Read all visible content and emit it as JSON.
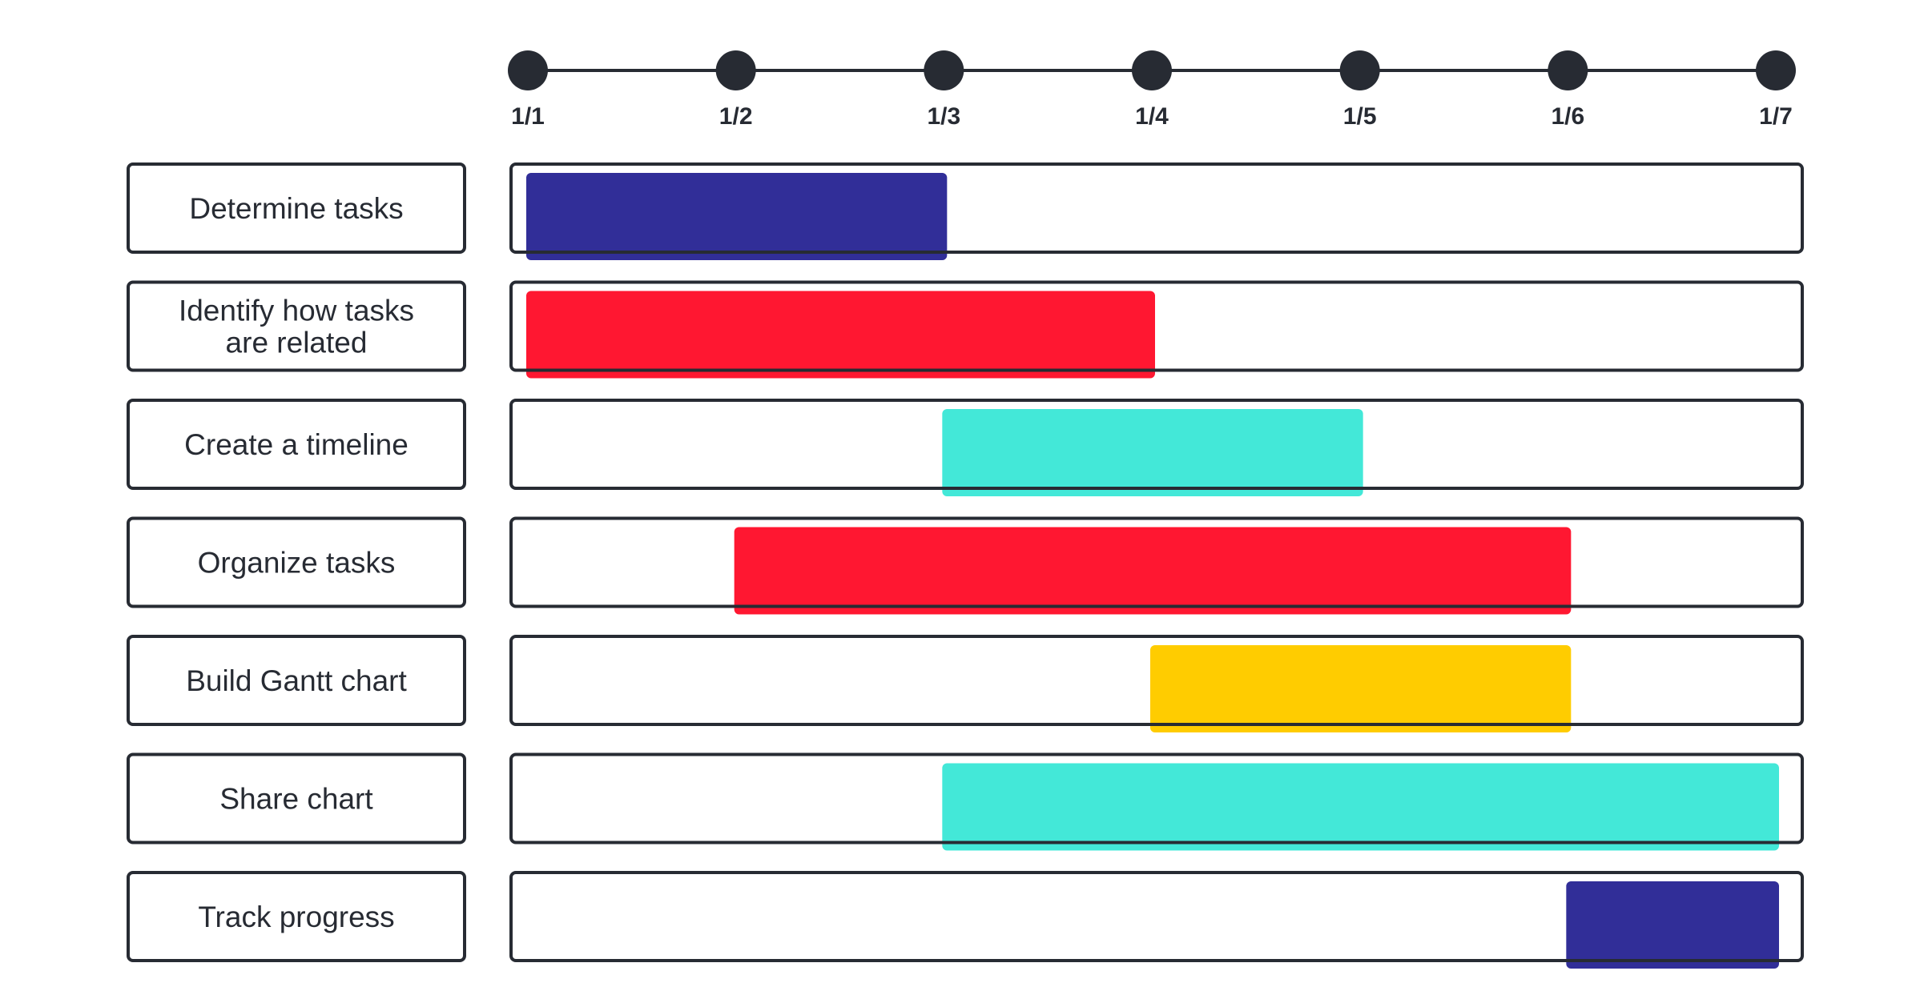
{
  "chart_data": {
    "type": "gantt",
    "title": "",
    "xlabel": "",
    "ylabel": "",
    "x_ticks": [
      "1/1",
      "1/2",
      "1/3",
      "1/4",
      "1/5",
      "1/6",
      "1/7"
    ],
    "x_range": [
      1,
      7
    ],
    "grid": false,
    "legend": "none",
    "tasks": [
      {
        "name": "Determine tasks",
        "lines": [
          "Determine tasks"
        ],
        "start": 1,
        "end": 3,
        "color": "#312e98"
      },
      {
        "name": "Identify how tasks are related",
        "lines": [
          "Identify how tasks",
          "are related"
        ],
        "start": 1,
        "end": 4,
        "color": "#ff1731"
      },
      {
        "name": "Create a timeline",
        "lines": [
          "Create a timeline"
        ],
        "start": 3,
        "end": 5,
        "color": "#43e8d8"
      },
      {
        "name": "Organize tasks",
        "lines": [
          "Organize tasks"
        ],
        "start": 2,
        "end": 6,
        "color": "#ff1731"
      },
      {
        "name": "Build Gantt chart",
        "lines": [
          "Build Gantt chart"
        ],
        "start": 4,
        "end": 6,
        "color": "#ffcc00"
      },
      {
        "name": "Share chart",
        "lines": [
          "Share chart"
        ],
        "start": 3,
        "end": 7,
        "color": "#43e8d8"
      },
      {
        "name": "Track progress",
        "lines": [
          "Track progress"
        ],
        "start": 6,
        "end": 7,
        "color": "#312e98"
      }
    ]
  },
  "colors": {
    "ink": "#272b33",
    "background": "#ffffff"
  }
}
